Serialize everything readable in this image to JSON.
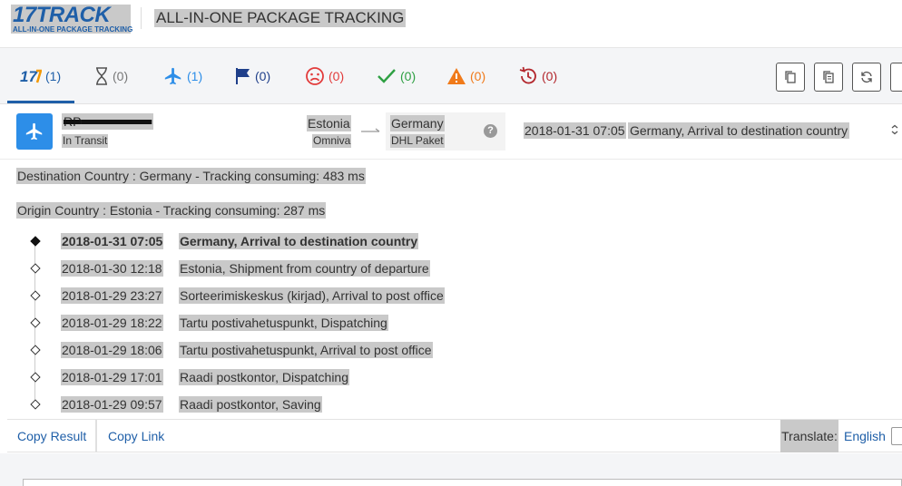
{
  "header": {
    "logo_main": "17TRACK",
    "logo_sub": "ALL-IN-ONE PACKAGE TRACKING",
    "title": "ALL-IN-ONE PACKAGE TRACKING"
  },
  "tabs": [
    {
      "icon": "17track-logo-icon",
      "count": "(1)",
      "color": "#1f5fa8",
      "active": true
    },
    {
      "icon": "hourglass-icon",
      "count": "(0)",
      "color": "#555555"
    },
    {
      "icon": "airplane-icon",
      "count": "(1)",
      "color": "#2d8ee8"
    },
    {
      "icon": "flag-icon",
      "count": "(0)",
      "color": "#1f3f8a"
    },
    {
      "icon": "sad-face-icon",
      "count": "(0)",
      "color": "#e23b3b"
    },
    {
      "icon": "checkmark-icon",
      "count": "(0)",
      "color": "#2ea043"
    },
    {
      "icon": "warning-icon",
      "count": "(0)",
      "color": "#f07a1a"
    },
    {
      "icon": "history-icon",
      "count": "(0)",
      "color": "#b3272d"
    }
  ],
  "toolbar": {
    "buttons": [
      "copy-icon",
      "copy-all-icon",
      "refresh-icon",
      "more-icon"
    ]
  },
  "package": {
    "number": "RP",
    "status": "In Transit",
    "origin_country": "Estonia",
    "origin_carrier": "Omniva",
    "dest_country": "Germany",
    "dest_carrier": "DHL Paket",
    "help_glyph": "?",
    "latest_time": "2018-01-31 07:05",
    "latest_event": "Germany, Arrival to destination country"
  },
  "details": {
    "destination_info": "Destination Country : Germany - Tracking consuming: 483 ms",
    "origin_info": "Origin Country : Estonia - Tracking consuming: 287 ms",
    "events": [
      {
        "time": "2018-01-31 07:05",
        "desc": "Germany, Arrival to destination country"
      },
      {
        "time": "2018-01-30 12:18",
        "desc": "Estonia, Shipment from country of departure"
      },
      {
        "time": "2018-01-29 23:27",
        "desc": "Sorteerimiskeskus (kirjad), Arrival to post office"
      },
      {
        "time": "2018-01-29 18:22",
        "desc": "Tartu postivahetuspunkt, Dispatching"
      },
      {
        "time": "2018-01-29 18:06",
        "desc": "Tartu postivahetuspunkt, Arrival to post office"
      },
      {
        "time": "2018-01-29 17:01",
        "desc": "Raadi postkontor, Dispatching"
      },
      {
        "time": "2018-01-29 09:57",
        "desc": "Raadi postkontor, Saving"
      }
    ]
  },
  "footer": {
    "copy_result": "Copy Result",
    "copy_link": "Copy Link",
    "translate_label": "Translate:",
    "language": "English"
  }
}
